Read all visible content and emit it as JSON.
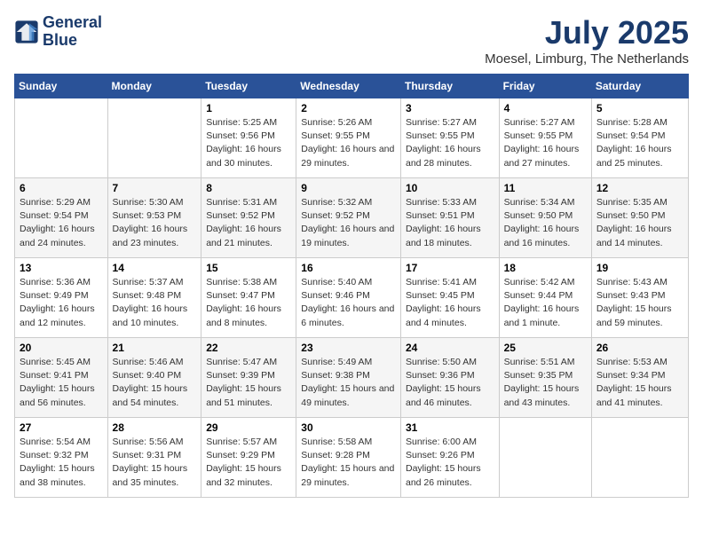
{
  "logo": {
    "line1": "General",
    "line2": "Blue"
  },
  "title": "July 2025",
  "location": "Moesel, Limburg, The Netherlands",
  "days_of_week": [
    "Sunday",
    "Monday",
    "Tuesday",
    "Wednesday",
    "Thursday",
    "Friday",
    "Saturday"
  ],
  "weeks": [
    [
      {
        "day": "",
        "sunrise": "",
        "sunset": "",
        "daylight": ""
      },
      {
        "day": "",
        "sunrise": "",
        "sunset": "",
        "daylight": ""
      },
      {
        "day": "1",
        "sunrise": "Sunrise: 5:25 AM",
        "sunset": "Sunset: 9:56 PM",
        "daylight": "Daylight: 16 hours and 30 minutes."
      },
      {
        "day": "2",
        "sunrise": "Sunrise: 5:26 AM",
        "sunset": "Sunset: 9:55 PM",
        "daylight": "Daylight: 16 hours and 29 minutes."
      },
      {
        "day": "3",
        "sunrise": "Sunrise: 5:27 AM",
        "sunset": "Sunset: 9:55 PM",
        "daylight": "Daylight: 16 hours and 28 minutes."
      },
      {
        "day": "4",
        "sunrise": "Sunrise: 5:27 AM",
        "sunset": "Sunset: 9:55 PM",
        "daylight": "Daylight: 16 hours and 27 minutes."
      },
      {
        "day": "5",
        "sunrise": "Sunrise: 5:28 AM",
        "sunset": "Sunset: 9:54 PM",
        "daylight": "Daylight: 16 hours and 25 minutes."
      }
    ],
    [
      {
        "day": "6",
        "sunrise": "Sunrise: 5:29 AM",
        "sunset": "Sunset: 9:54 PM",
        "daylight": "Daylight: 16 hours and 24 minutes."
      },
      {
        "day": "7",
        "sunrise": "Sunrise: 5:30 AM",
        "sunset": "Sunset: 9:53 PM",
        "daylight": "Daylight: 16 hours and 23 minutes."
      },
      {
        "day": "8",
        "sunrise": "Sunrise: 5:31 AM",
        "sunset": "Sunset: 9:52 PM",
        "daylight": "Daylight: 16 hours and 21 minutes."
      },
      {
        "day": "9",
        "sunrise": "Sunrise: 5:32 AM",
        "sunset": "Sunset: 9:52 PM",
        "daylight": "Daylight: 16 hours and 19 minutes."
      },
      {
        "day": "10",
        "sunrise": "Sunrise: 5:33 AM",
        "sunset": "Sunset: 9:51 PM",
        "daylight": "Daylight: 16 hours and 18 minutes."
      },
      {
        "day": "11",
        "sunrise": "Sunrise: 5:34 AM",
        "sunset": "Sunset: 9:50 PM",
        "daylight": "Daylight: 16 hours and 16 minutes."
      },
      {
        "day": "12",
        "sunrise": "Sunrise: 5:35 AM",
        "sunset": "Sunset: 9:50 PM",
        "daylight": "Daylight: 16 hours and 14 minutes."
      }
    ],
    [
      {
        "day": "13",
        "sunrise": "Sunrise: 5:36 AM",
        "sunset": "Sunset: 9:49 PM",
        "daylight": "Daylight: 16 hours and 12 minutes."
      },
      {
        "day": "14",
        "sunrise": "Sunrise: 5:37 AM",
        "sunset": "Sunset: 9:48 PM",
        "daylight": "Daylight: 16 hours and 10 minutes."
      },
      {
        "day": "15",
        "sunrise": "Sunrise: 5:38 AM",
        "sunset": "Sunset: 9:47 PM",
        "daylight": "Daylight: 16 hours and 8 minutes."
      },
      {
        "day": "16",
        "sunrise": "Sunrise: 5:40 AM",
        "sunset": "Sunset: 9:46 PM",
        "daylight": "Daylight: 16 hours and 6 minutes."
      },
      {
        "day": "17",
        "sunrise": "Sunrise: 5:41 AM",
        "sunset": "Sunset: 9:45 PM",
        "daylight": "Daylight: 16 hours and 4 minutes."
      },
      {
        "day": "18",
        "sunrise": "Sunrise: 5:42 AM",
        "sunset": "Sunset: 9:44 PM",
        "daylight": "Daylight: 16 hours and 1 minute."
      },
      {
        "day": "19",
        "sunrise": "Sunrise: 5:43 AM",
        "sunset": "Sunset: 9:43 PM",
        "daylight": "Daylight: 15 hours and 59 minutes."
      }
    ],
    [
      {
        "day": "20",
        "sunrise": "Sunrise: 5:45 AM",
        "sunset": "Sunset: 9:41 PM",
        "daylight": "Daylight: 15 hours and 56 minutes."
      },
      {
        "day": "21",
        "sunrise": "Sunrise: 5:46 AM",
        "sunset": "Sunset: 9:40 PM",
        "daylight": "Daylight: 15 hours and 54 minutes."
      },
      {
        "day": "22",
        "sunrise": "Sunrise: 5:47 AM",
        "sunset": "Sunset: 9:39 PM",
        "daylight": "Daylight: 15 hours and 51 minutes."
      },
      {
        "day": "23",
        "sunrise": "Sunrise: 5:49 AM",
        "sunset": "Sunset: 9:38 PM",
        "daylight": "Daylight: 15 hours and 49 minutes."
      },
      {
        "day": "24",
        "sunrise": "Sunrise: 5:50 AM",
        "sunset": "Sunset: 9:36 PM",
        "daylight": "Daylight: 15 hours and 46 minutes."
      },
      {
        "day": "25",
        "sunrise": "Sunrise: 5:51 AM",
        "sunset": "Sunset: 9:35 PM",
        "daylight": "Daylight: 15 hours and 43 minutes."
      },
      {
        "day": "26",
        "sunrise": "Sunrise: 5:53 AM",
        "sunset": "Sunset: 9:34 PM",
        "daylight": "Daylight: 15 hours and 41 minutes."
      }
    ],
    [
      {
        "day": "27",
        "sunrise": "Sunrise: 5:54 AM",
        "sunset": "Sunset: 9:32 PM",
        "daylight": "Daylight: 15 hours and 38 minutes."
      },
      {
        "day": "28",
        "sunrise": "Sunrise: 5:56 AM",
        "sunset": "Sunset: 9:31 PM",
        "daylight": "Daylight: 15 hours and 35 minutes."
      },
      {
        "day": "29",
        "sunrise": "Sunrise: 5:57 AM",
        "sunset": "Sunset: 9:29 PM",
        "daylight": "Daylight: 15 hours and 32 minutes."
      },
      {
        "day": "30",
        "sunrise": "Sunrise: 5:58 AM",
        "sunset": "Sunset: 9:28 PM",
        "daylight": "Daylight: 15 hours and 29 minutes."
      },
      {
        "day": "31",
        "sunrise": "Sunrise: 6:00 AM",
        "sunset": "Sunset: 9:26 PM",
        "daylight": "Daylight: 15 hours and 26 minutes."
      },
      {
        "day": "",
        "sunrise": "",
        "sunset": "",
        "daylight": ""
      },
      {
        "day": "",
        "sunrise": "",
        "sunset": "",
        "daylight": ""
      }
    ]
  ]
}
